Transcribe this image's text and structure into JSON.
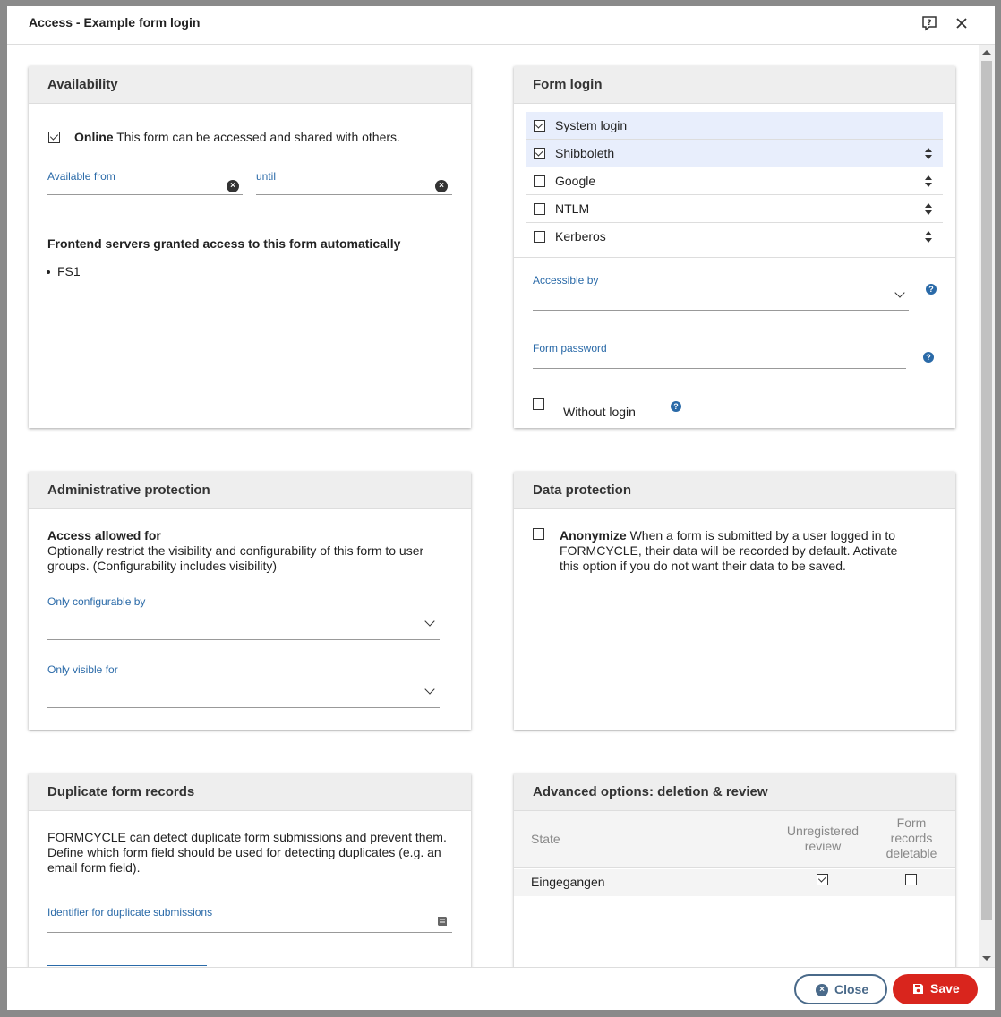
{
  "dialog": {
    "title": "Access - Example form login"
  },
  "availability": {
    "heading": "Availability",
    "online_label": "Online",
    "online_text": "This form can be accessed and shared with others.",
    "available_from_label": "Available from",
    "until_label": "until",
    "frontend_heading": "Frontend servers granted access to this form automatically",
    "frontend_servers": [
      "FS1"
    ]
  },
  "form_login": {
    "heading": "Form login",
    "methods": [
      {
        "label": "System login",
        "checked": true
      },
      {
        "label": "Shibboleth",
        "checked": true
      },
      {
        "label": "Google",
        "checked": false
      },
      {
        "label": "NTLM",
        "checked": false
      },
      {
        "label": "Kerberos",
        "checked": false
      }
    ],
    "accessible_by_label": "Accessible by",
    "password_label": "Form password",
    "without_login_label": "Without login"
  },
  "admin_protection": {
    "heading": "Administrative protection",
    "access_heading": "Access allowed for",
    "access_text": "Optionally restrict the visibility and configurability of this form to user groups. (Configurability includes visibility)",
    "configurable_label": "Only configurable by",
    "visible_label": "Only visible for"
  },
  "data_protection": {
    "heading": "Data protection",
    "anonymize_label": "Anonymize",
    "anonymize_text": "When a form is submitted by a user logged in to FORMCYCLE, their data will be recorded by default. Activate this option if you do not want their data to be saved."
  },
  "duplicates": {
    "heading": "Duplicate form records",
    "text": "FORMCYCLE can detect duplicate form submissions and prevent them. Define which form field should be used for detecting duplicates (e.g. an email form field).",
    "identifier_label": "Identifier for duplicate submissions"
  },
  "advanced": {
    "heading": "Advanced options: deletion & review",
    "col_state": "State",
    "col_review_1": "Unregistered",
    "col_review_2": "review",
    "col_delete_1": "Form",
    "col_delete_2": "records",
    "col_delete_3": "deletable",
    "row_state": "Eingegangen",
    "row_review": true,
    "row_delete": false
  },
  "footer": {
    "close_label": "Close",
    "save_label": "Save"
  },
  "colors": {
    "accent": "#2a6aa8",
    "save": "#d9251d",
    "close_border": "#4a6a8a"
  }
}
